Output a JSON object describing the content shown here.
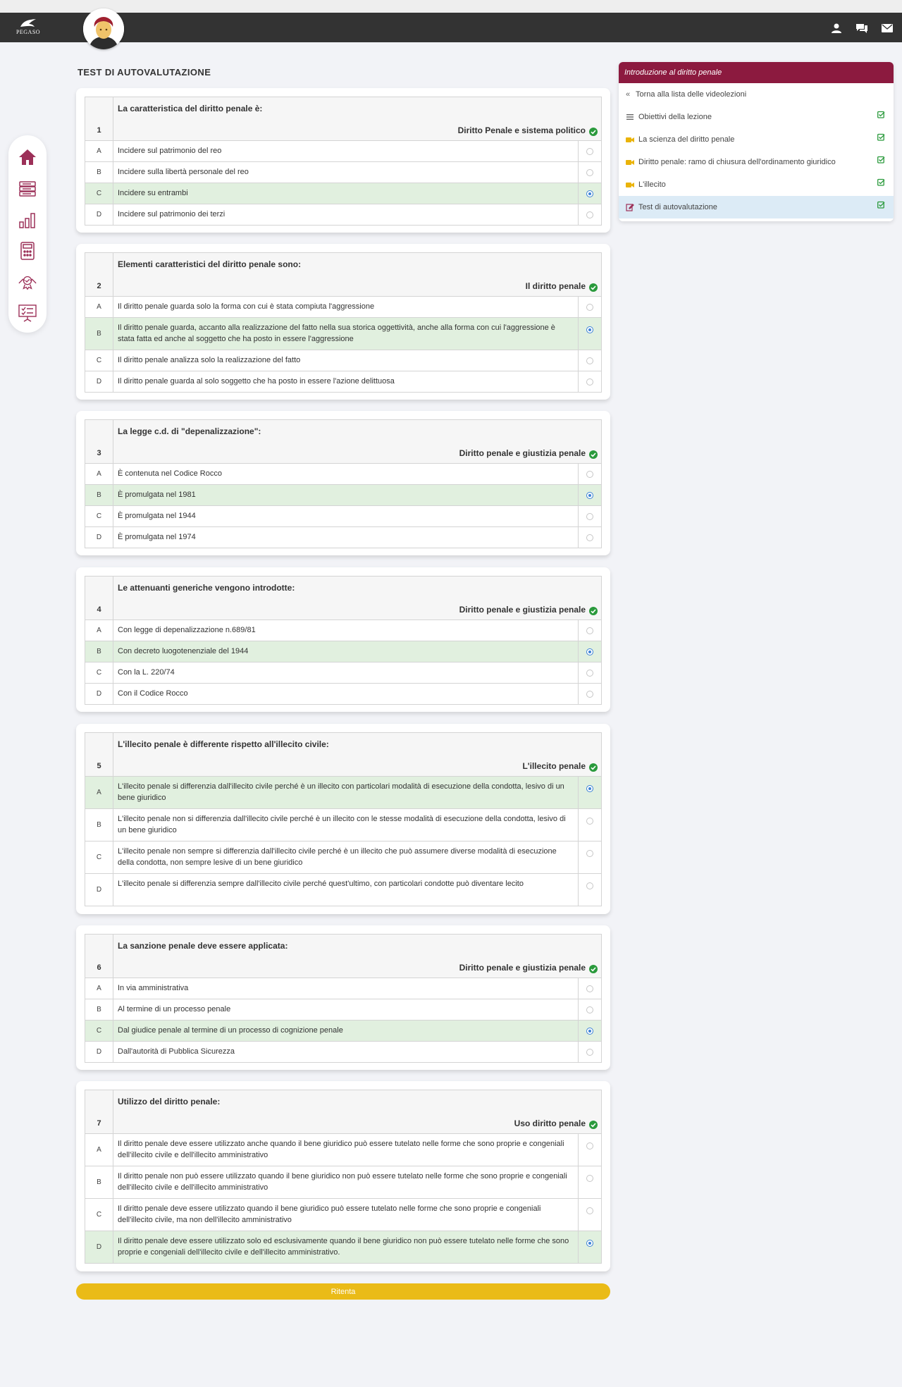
{
  "header": {
    "logo_text": "PEGASO",
    "icons": [
      "user-icon",
      "chat-icon",
      "mail-icon"
    ]
  },
  "sidenav": {
    "items": [
      "home-icon",
      "books-icon",
      "chart-icon",
      "calculator-icon",
      "certificate-icon",
      "presentation-icon"
    ]
  },
  "page": {
    "title": "TEST DI AUTOVALUTAZIONE"
  },
  "colors": {
    "brand": "#8c1a3f",
    "correct_bg": "#e1f0df",
    "radio_selected": "#3c82d6",
    "retry_button": "#eabb17",
    "check_green": "#2a9a3c",
    "video_icon": "#eab308"
  },
  "questions": [
    {
      "number": "1",
      "text": "La caratteristica del diritto penale è:",
      "topic": "Diritto Penale e sistema politico",
      "answers": [
        {
          "letter": "A",
          "text": "Incidere sul patrimonio del reo",
          "correct": false
        },
        {
          "letter": "B",
          "text": "Incidere sulla libertà personale del reo",
          "correct": false
        },
        {
          "letter": "C",
          "text": "Incidere su entrambi",
          "correct": true
        },
        {
          "letter": "D",
          "text": "Incidere sul patrimonio dei terzi",
          "correct": false
        }
      ]
    },
    {
      "number": "2",
      "text": "Elementi caratteristici del diritto penale sono:",
      "topic": "Il diritto penale",
      "answers": [
        {
          "letter": "A",
          "text": "Il diritto penale guarda solo la forma con cui è stata compiuta l'aggressione",
          "correct": false
        },
        {
          "letter": "B",
          "text": "Il diritto penale guarda, accanto alla realizzazione del fatto nella sua storica oggettività, anche alla forma con cui l'aggressione è stata fatta ed anche al soggetto che ha posto in essere l'aggressione",
          "correct": true
        },
        {
          "letter": "C",
          "text": "Il diritto penale analizza solo la realizzazione del fatto",
          "correct": false
        },
        {
          "letter": "D",
          "text": "Il diritto penale guarda al solo soggetto che ha posto in essere l'azione delittuosa",
          "correct": false
        }
      ]
    },
    {
      "number": "3",
      "text": "La legge c.d. di \"depenalizzazione\":",
      "topic": "Diritto penale e giustizia penale",
      "answers": [
        {
          "letter": "A",
          "text": "È contenuta nel Codice Rocco",
          "correct": false
        },
        {
          "letter": "B",
          "text": "È promulgata nel 1981",
          "correct": true
        },
        {
          "letter": "C",
          "text": "È promulgata nel 1944",
          "correct": false
        },
        {
          "letter": "D",
          "text": "È promulgata nel 1974",
          "correct": false
        }
      ]
    },
    {
      "number": "4",
      "text": "Le attenuanti generiche vengono introdotte:",
      "topic": "Diritto penale e giustizia penale",
      "answers": [
        {
          "letter": "A",
          "text": "Con legge di depenalizzazione n.689/81",
          "correct": false
        },
        {
          "letter": "B",
          "text": "Con decreto luogotenenziale del 1944",
          "correct": true
        },
        {
          "letter": "C",
          "text": "Con la L. 220/74",
          "correct": false
        },
        {
          "letter": "D",
          "text": "Con il Codice Rocco",
          "correct": false
        }
      ]
    },
    {
      "number": "5",
      "text": "L'illecito penale è differente rispetto all'illecito civile:",
      "topic": "L'illecito penale",
      "answers": [
        {
          "letter": "A",
          "text": "L'illecito penale si differenzia dall'illecito civile perché è un illecito con particolari modalità di esecuzione della condotta, lesivo di un bene giuridico",
          "correct": true
        },
        {
          "letter": "B",
          "text": "L'illecito penale non si differenzia dall'illecito civile perché è un illecito con le stesse modalità di esecuzione della condotta, lesivo di un bene giuridico",
          "correct": false
        },
        {
          "letter": "C",
          "text": "L'illecito penale non sempre si differenzia dall'illecito civile perché è un illecito che può assumere diverse modalità di esecuzione della condotta, non sempre lesive di un bene giuridico",
          "correct": false
        },
        {
          "letter": "D",
          "text": "L'illecito penale si differenzia sempre dall'illecito civile perché quest'ultimo, con particolari condotte può diventare lecito",
          "correct": false
        }
      ]
    },
    {
      "number": "6",
      "text": "La sanzione penale deve essere applicata:",
      "topic": "Diritto penale e giustizia penale",
      "answers": [
        {
          "letter": "A",
          "text": "In via amministrativa",
          "correct": false
        },
        {
          "letter": "B",
          "text": "Al termine di un processo penale",
          "correct": false
        },
        {
          "letter": "C",
          "text": "Dal giudice penale al termine di un processo di cognizione penale",
          "correct": true
        },
        {
          "letter": "D",
          "text": "Dall'autorità di Pubblica Sicurezza",
          "correct": false
        }
      ]
    },
    {
      "number": "7",
      "text": "Utilizzo del diritto penale:",
      "topic": "Uso diritto penale",
      "answers": [
        {
          "letter": "A",
          "text": "Il diritto penale deve essere utilizzato anche quando il bene giuridico può essere tutelato nelle forme che sono proprie e congeniali dell'illecito civile e dell'illecito amministrativo",
          "correct": false
        },
        {
          "letter": "B",
          "text": "Il diritto penale non può essere utilizzato quando il bene giuridico non può essere tutelato nelle forme che sono proprie e congeniali dell'illecito civile e dell'illecito amministrativo",
          "correct": false
        },
        {
          "letter": "C",
          "text": "Il diritto penale deve essere utilizzato quando il bene giuridico può essere tutelato nelle forme che sono proprie e congeniali dell'illecito civile, ma non dell'illecito amministrativo",
          "correct": false
        },
        {
          "letter": "D",
          "text": "Il diritto penale deve essere utilizzato solo ed esclusivamente quando il bene giuridico non può essere tutelato nelle forme che sono proprie e congeniali dell'illecito civile e dell'illecito amministrativo.",
          "correct": true
        }
      ]
    }
  ],
  "retry_label": "Ritenta",
  "panel": {
    "title": "Introduzione al diritto penale",
    "back_label": "Torna alla lista delle videolezioni",
    "items": [
      {
        "label": "Obiettivi della lezione",
        "icon": "list-icon",
        "done": true,
        "active": false
      },
      {
        "label": "La scienza del diritto penale",
        "icon": "video-icon",
        "done": true,
        "active": false
      },
      {
        "label": "Diritto penale: ramo di chiusura dell'ordinamento giuridico",
        "icon": "video-icon",
        "done": true,
        "active": false
      },
      {
        "label": "L'illecito",
        "icon": "video-icon",
        "done": true,
        "active": false
      },
      {
        "label": "Test di autovalutazione",
        "icon": "edit-icon",
        "done": true,
        "active": true
      }
    ]
  }
}
